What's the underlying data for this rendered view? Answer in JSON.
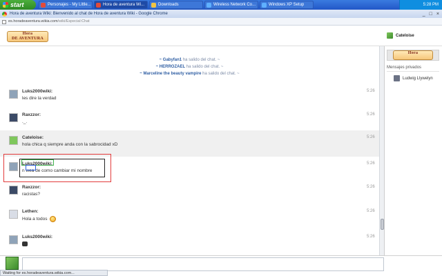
{
  "taskbar": {
    "start_label": "start",
    "tasks": [
      {
        "label": "Personajes - My Little...",
        "color": "#e14b3b"
      },
      {
        "label": "Hora de aventura Wi...",
        "color": "#e14b3b"
      },
      {
        "label": "Downloads",
        "color": "#f2c442"
      },
      {
        "label": "Wireless Network Co...",
        "color": "#5fb0ff"
      },
      {
        "label": "Windows XP Setup",
        "color": "#5fb0ff"
      }
    ],
    "clock": "5:28 PM"
  },
  "window": {
    "title": "Hora de aventura Wiki: Bienvenido al chat de Hora de aventura Wiki - Google Chrome",
    "controls": [
      "_",
      "□",
      "×"
    ]
  },
  "address": {
    "domain": "es.horadeaventura.wikia.com",
    "path": "/wiki/Especial:Chat"
  },
  "header": {
    "logo_line1": "Hora",
    "logo_line2": "DE AVENTURA",
    "current_user": "Cateloise"
  },
  "alerts": [
    {
      "user": "~ Gabyfan1",
      "text": " ha salido del chat. ~"
    },
    {
      "user": "~ HERROZAEL",
      "text": " ha salido del chat. ~"
    },
    {
      "user": "~ Marceline the beauty vampire",
      "text": " ha salido del chat. ~"
    }
  ],
  "messages": [
    {
      "user": "Luks2000wiki:",
      "text": "les dire la verdad",
      "time": "5:26",
      "avatar": "#8fa3b8"
    },
    {
      "user": "Raxzzor:",
      "text": "._.",
      "time": "5:26",
      "avatar": "#3b4a66"
    },
    {
      "user": "Cateloise:",
      "text": "hola chica q siempre anda con la sabrocidad xD",
      "time": "5:26",
      "avatar": "#7fc75c"
    },
    {
      "user": "Luks2000wiki:",
      "text": "n wea de como cambiar mi nombre",
      "time": "5:26",
      "avatar": "#8fa3b8"
    },
    {
      "user": "Raxzzor:",
      "text": "racistas?",
      "time": "5:26",
      "avatar": "#3b4a66"
    },
    {
      "user": "Lethen:",
      "text": "Hola a todos",
      "time": "5:26",
      "avatar": "#d9dde6"
    },
    {
      "user": "Luks2000wiki:",
      "text": "",
      "time": "5:26",
      "avatar": "#8fa3b8"
    }
  ],
  "rail": {
    "section_title": "Mensajes privados",
    "pm_user": "Ludwig Llywelyn"
  },
  "status": "Waiting for es.horadeaventura.wikia.com..."
}
